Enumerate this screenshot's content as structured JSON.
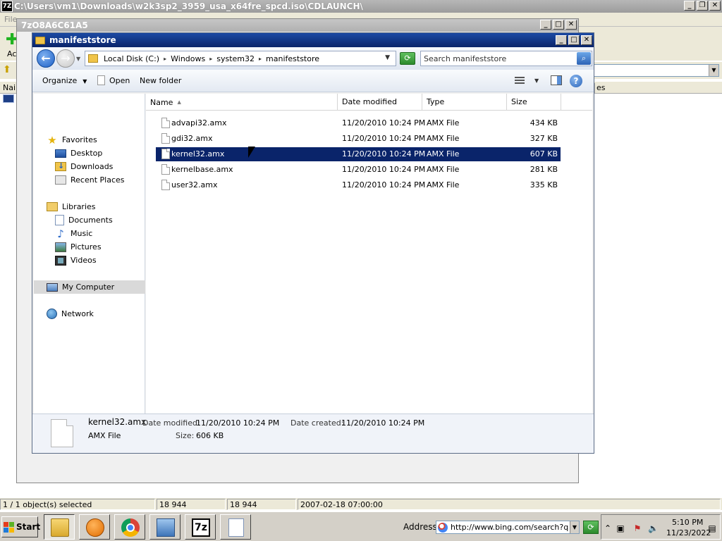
{
  "sevenzip": {
    "title": "C:\\Users\\vm1\\Downloads\\w2k3sp2_3959_usa_x64fre_spcd.iso\\CDLAUNCH\\",
    "logo": "7Z",
    "menu_file": "File",
    "add_label": "Ac",
    "list_header_name": "Nai",
    "list_header_es": "es",
    "status": [
      "1 / 1 object(s) selected",
      "18 944",
      "18 944",
      "2007-02-18 07:00:00"
    ]
  },
  "window_7zo": {
    "title": "7zO8A6C61A5"
  },
  "explorer": {
    "title": "manifeststore",
    "breadcrumb": [
      "Local Disk (C:)",
      "Windows",
      "system32",
      "manifeststore"
    ],
    "search_placeholder": "Search manifeststore",
    "commands": {
      "organize": "Organize",
      "open": "Open",
      "new_folder": "New folder"
    },
    "nav": {
      "favorites": "Favorites",
      "desktop": "Desktop",
      "downloads": "Downloads",
      "recent_places": "Recent Places",
      "libraries": "Libraries",
      "documents": "Documents",
      "music": "Music",
      "pictures": "Pictures",
      "videos": "Videos",
      "my_computer": "My Computer",
      "network": "Network"
    },
    "columns": {
      "name": "Name",
      "date_modified": "Date modified",
      "type": "Type",
      "size": "Size"
    },
    "files": [
      {
        "name": "advapi32.amx",
        "date": "11/20/2010 10:24 PM",
        "type": "AMX File",
        "size": "434 KB"
      },
      {
        "name": "gdi32.amx",
        "date": "11/20/2010 10:24 PM",
        "type": "AMX File",
        "size": "327 KB"
      },
      {
        "name": "kernel32.amx",
        "date": "11/20/2010 10:24 PM",
        "type": "AMX File",
        "size": "607 KB"
      },
      {
        "name": "kernelbase.amx",
        "date": "11/20/2010 10:24 PM",
        "type": "AMX File",
        "size": "281 KB"
      },
      {
        "name": "user32.amx",
        "date": "11/20/2010 10:24 PM",
        "type": "AMX File",
        "size": "335 KB"
      }
    ],
    "details": {
      "name": "kernel32.amx",
      "type": "AMX File",
      "date_modified_label": "Date modified:",
      "date_modified": "11/20/2010 10:24 PM",
      "date_created_label": "Date created:",
      "date_created": "11/20/2010 10:24 PM",
      "size_label": "Size:",
      "size": "606 KB"
    }
  },
  "taskbar": {
    "start": "Start",
    "address_label": "Address",
    "address_value": "http://www.bing.com/search?q=w",
    "clock_time": "5:10 PM",
    "clock_date": "11/23/2022"
  }
}
